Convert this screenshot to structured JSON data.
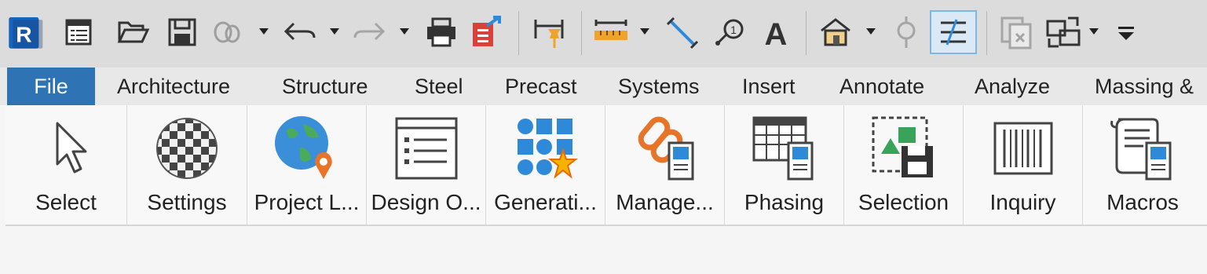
{
  "colors": {
    "file_tab_bg": "#2e74b5",
    "accent_orange": "#e8742a",
    "accent_blue": "#2e8ad8",
    "accent_green": "#3aa35a"
  },
  "quick_access": {
    "icons": [
      "revit-logo-icon",
      "recent-files-icon",
      "open-folder-icon",
      "save-icon",
      "sync-icon",
      "undo-icon",
      "redo-icon",
      "print-icon",
      "export-icon",
      "aligned-dimension-icon",
      "measure-icon",
      "angular-dimension-icon",
      "tag-icon",
      "text-icon",
      "default-3d-view-icon",
      "section-icon",
      "thin-lines-icon",
      "close-inactive-views-icon",
      "switch-windows-icon",
      "customize-qat-icon"
    ],
    "logo_letter": "R",
    "text_tool_letter": "A"
  },
  "tabs": [
    "File",
    "Architecture",
    "Structure",
    "Steel",
    "Precast",
    "Systems",
    "Insert",
    "Annotate",
    "Analyze",
    "Massing &"
  ],
  "tools": [
    {
      "label": "Select",
      "icon": "cursor-arrow-icon"
    },
    {
      "label": "Settings",
      "icon": "checkered-sphere-icon"
    },
    {
      "label": "Project L...",
      "icon": "globe-location-icon"
    },
    {
      "label": "Design O...",
      "icon": "list-window-icon"
    },
    {
      "label": "Generati...",
      "icon": "grid-spark-icon"
    },
    {
      "label": "Manage...",
      "icon": "link-chain-icon"
    },
    {
      "label": "Phasing",
      "icon": "phasing-table-icon"
    },
    {
      "label": "Selection",
      "icon": "save-selection-icon"
    },
    {
      "label": "Inquiry",
      "icon": "barcode-icon"
    },
    {
      "label": "Macros",
      "icon": "scroll-macro-icon"
    }
  ]
}
